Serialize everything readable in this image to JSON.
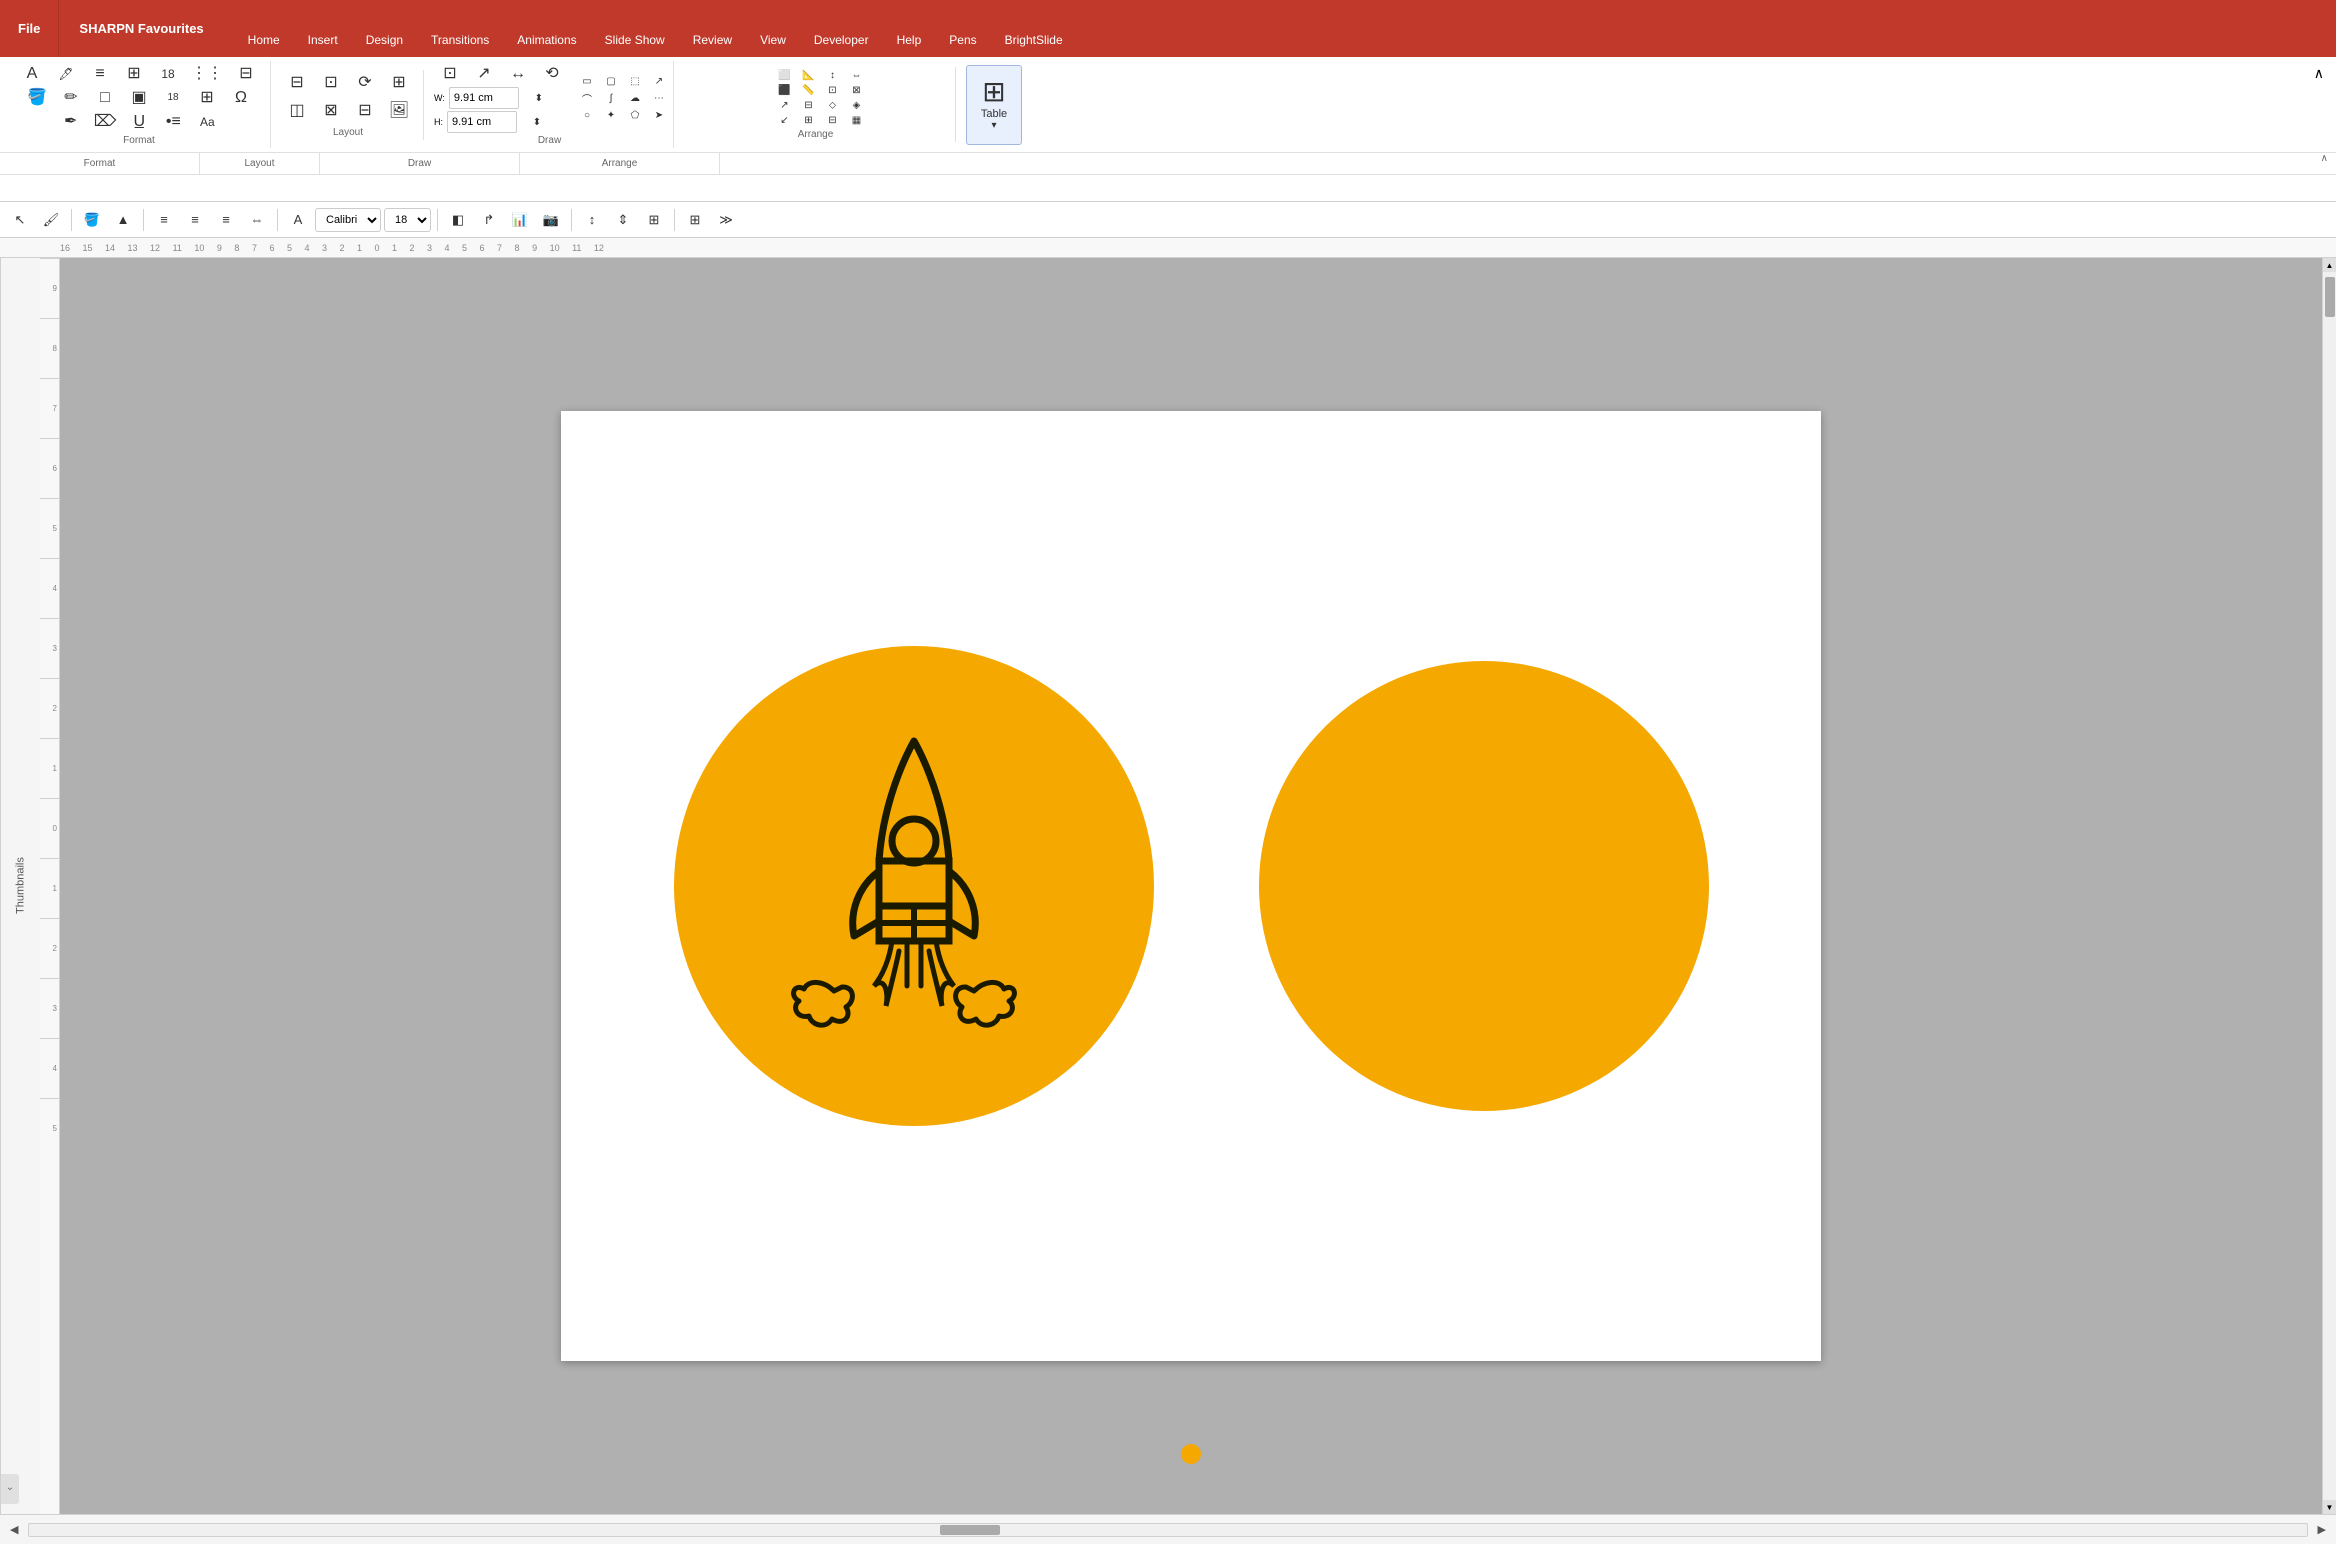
{
  "app": {
    "title": "SHARPN Favourites",
    "file_label": "File"
  },
  "ribbon_tabs": [
    {
      "label": "File",
      "active": false
    },
    {
      "label": "SHARPN Favourites",
      "active": false
    },
    {
      "label": "Home",
      "active": false
    },
    {
      "label": "Insert",
      "active": false
    },
    {
      "label": "Design",
      "active": false
    },
    {
      "label": "Transitions",
      "active": false
    },
    {
      "label": "Animations",
      "active": false
    },
    {
      "label": "Slide Show",
      "active": false
    },
    {
      "label": "Review",
      "active": false
    },
    {
      "label": "View",
      "active": false
    },
    {
      "label": "Developer",
      "active": false
    },
    {
      "label": "Help",
      "active": false
    },
    {
      "label": "Pens",
      "active": false
    },
    {
      "label": "BrightSlide",
      "active": false
    }
  ],
  "ribbon_groups": {
    "format_label": "Format",
    "layout_label": "Layout",
    "draw_label": "Draw",
    "arrange_label": "Arrange",
    "table_label": "Table"
  },
  "dimension_inputs": {
    "width_val": "9.91 cm",
    "height_val": "9.91 cm"
  },
  "slide": {
    "circle_left_color": "#F5A800",
    "circle_right_color": "#F5A800",
    "has_rocket": true
  },
  "thumbnails_label": "Thumbnails",
  "status_bar": {
    "left_arrow": "◀",
    "right_arrow": "▶"
  }
}
